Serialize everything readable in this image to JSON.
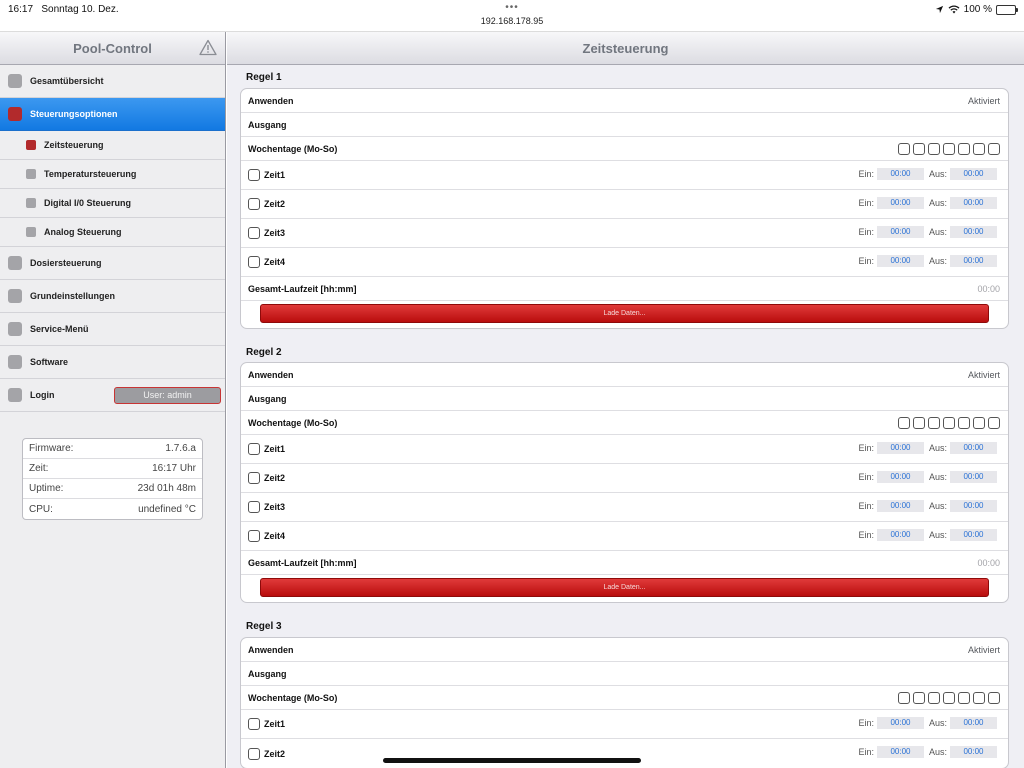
{
  "status": {
    "time": "16:17",
    "date": "Sonntag 10. Dez.",
    "url": "192.168.178.95",
    "battery": "100 %",
    "battery_level": 1.0
  },
  "sidebar": {
    "title": "Pool-Control",
    "items": [
      {
        "label": "Gesamtübersicht"
      },
      {
        "label": "Steuerungsoptionen"
      },
      {
        "label": "Zeitsteuerung"
      },
      {
        "label": "Temperatursteuerung"
      },
      {
        "label": "Digital I/0 Steuerung"
      },
      {
        "label": "Analog Steuerung"
      },
      {
        "label": "Dosiersteuerung"
      },
      {
        "label": "Grundeinstellungen"
      },
      {
        "label": "Service-Menü"
      },
      {
        "label": "Software"
      },
      {
        "label": "Login"
      }
    ],
    "user_button": "User: admin",
    "info": [
      {
        "label": "Firmware:",
        "value": "1.7.6.a"
      },
      {
        "label": "Zeit:",
        "value": "16:17 Uhr"
      },
      {
        "label": "Uptime:",
        "value": "23d 01h 48m"
      },
      {
        "label": "CPU:",
        "value": "undefined °C"
      }
    ]
  },
  "main": {
    "title": "Zeitsteuerung",
    "rules": [
      {
        "title": "Regel 1",
        "apply_label": "Anwenden",
        "apply_value": "Aktiviert",
        "output_label": "Ausgang",
        "weekdays_label": "Wochentage (Mo-So)",
        "times": [
          {
            "label": "Zeit1",
            "on_label": "Ein:",
            "on": "00:00",
            "off_label": "Aus:",
            "off": "00:00"
          },
          {
            "label": "Zeit2",
            "on_label": "Ein:",
            "on": "00:00",
            "off_label": "Aus:",
            "off": "00:00"
          },
          {
            "label": "Zeit3",
            "on_label": "Ein:",
            "on": "00:00",
            "off_label": "Aus:",
            "off": "00:00"
          },
          {
            "label": "Zeit4",
            "on_label": "Ein:",
            "on": "00:00",
            "off_label": "Aus:",
            "off": "00:00"
          }
        ],
        "total_label": "Gesamt-Laufzeit [hh:mm]",
        "total_value": "00:00",
        "load_button": "Lade Daten..."
      },
      {
        "title": "Regel 2",
        "apply_label": "Anwenden",
        "apply_value": "Aktiviert",
        "output_label": "Ausgang",
        "weekdays_label": "Wochentage (Mo-So)",
        "times": [
          {
            "label": "Zeit1",
            "on_label": "Ein:",
            "on": "00:00",
            "off_label": "Aus:",
            "off": "00:00"
          },
          {
            "label": "Zeit2",
            "on_label": "Ein:",
            "on": "00:00",
            "off_label": "Aus:",
            "off": "00:00"
          },
          {
            "label": "Zeit3",
            "on_label": "Ein:",
            "on": "00:00",
            "off_label": "Aus:",
            "off": "00:00"
          },
          {
            "label": "Zeit4",
            "on_label": "Ein:",
            "on": "00:00",
            "off_label": "Aus:",
            "off": "00:00"
          }
        ],
        "total_label": "Gesamt-Laufzeit [hh:mm]",
        "total_value": "00:00",
        "load_button": "Lade Daten..."
      },
      {
        "title": "Regel 3",
        "apply_label": "Anwenden",
        "apply_value": "Aktiviert",
        "output_label": "Ausgang",
        "weekdays_label": "Wochentage (Mo-So)",
        "times": [
          {
            "label": "Zeit1",
            "on_label": "Ein:",
            "on": "00:00",
            "off_label": "Aus:",
            "off": "00:00"
          },
          {
            "label": "Zeit2",
            "on_label": "Ein:",
            "on": "00:00",
            "off_label": "Aus:",
            "off": "00:00"
          }
        ]
      }
    ]
  },
  "colors": {
    "accent_blue": "#1a7fe8",
    "button_red": "#c81e1e",
    "indicator_red": "#b22a2c"
  }
}
